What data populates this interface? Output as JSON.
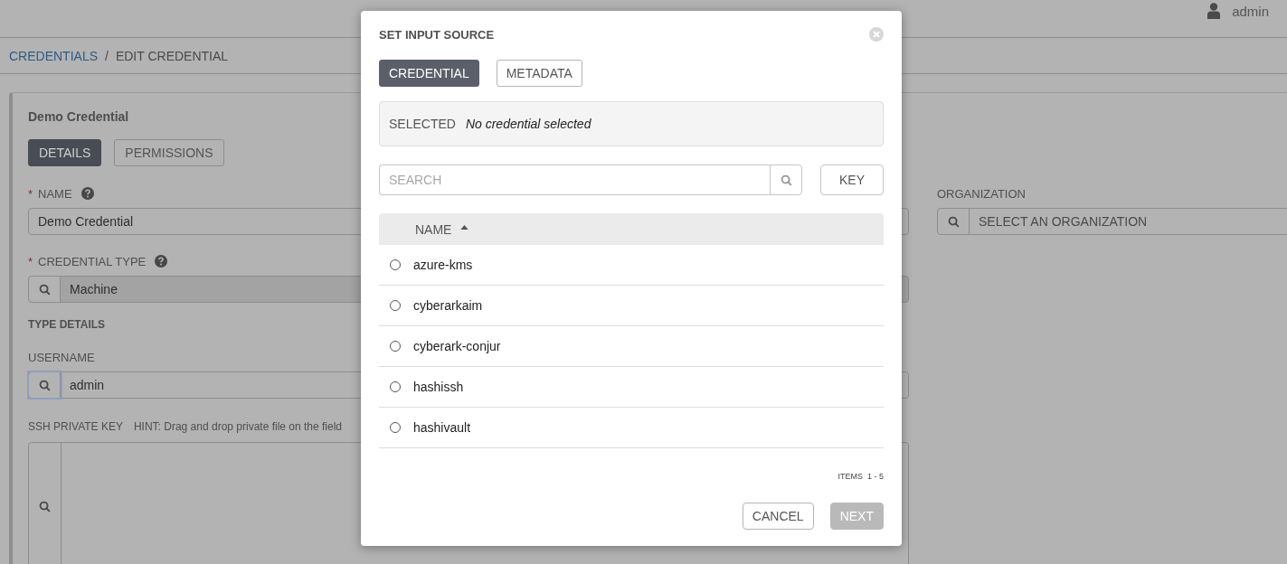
{
  "header": {
    "user": "admin"
  },
  "breadcrumb": {
    "items": [
      {
        "label": "CREDENTIALS",
        "link": true
      },
      {
        "label": "EDIT CREDENTIAL",
        "link": false
      }
    ],
    "separator": "/"
  },
  "card": {
    "title": "Demo Credential",
    "tabs": [
      {
        "label": "DETAILS",
        "selected": true
      },
      {
        "label": "PERMISSIONS",
        "selected": false
      }
    ],
    "name": {
      "required_mark": "*",
      "label": "NAME",
      "value": "Demo Credential"
    },
    "organization": {
      "label": "ORGANIZATION",
      "placeholder": "SELECT AN ORGANIZATION"
    },
    "credential_type": {
      "required_mark": "*",
      "label": "CREDENTIAL TYPE",
      "value": "Machine"
    },
    "section_title": "TYPE DETAILS",
    "username": {
      "label": "USERNAME",
      "value": "admin"
    },
    "ssh_key": {
      "label": "SSH PRIVATE KEY",
      "hint": "HINT: Drag and drop private file on the field"
    }
  },
  "modal": {
    "title": "SET INPUT SOURCE",
    "tabs": [
      {
        "label": "CREDENTIAL",
        "selected": true
      },
      {
        "label": "METADATA",
        "selected": false
      }
    ],
    "selected_label": "SELECTED",
    "selected_value": "No credential selected",
    "search": {
      "placeholder": "SEARCH"
    },
    "key_button": "KEY",
    "table": {
      "columns": [
        {
          "label": "NAME",
          "sorted_ascending": true
        }
      ],
      "rows": [
        {
          "name": "azure-kms",
          "selected": false
        },
        {
          "name": "cyberarkaim",
          "selected": false
        },
        {
          "name": "cyberark-conjur",
          "selected": false
        },
        {
          "name": "hashissh",
          "selected": false
        },
        {
          "name": "hashivault",
          "selected": false
        }
      ]
    },
    "items_label": "ITEMS",
    "items_range": "1 - 5",
    "buttons": [
      {
        "label": "CANCEL",
        "disabled": false
      },
      {
        "label": "NEXT",
        "disabled": true
      }
    ]
  }
}
